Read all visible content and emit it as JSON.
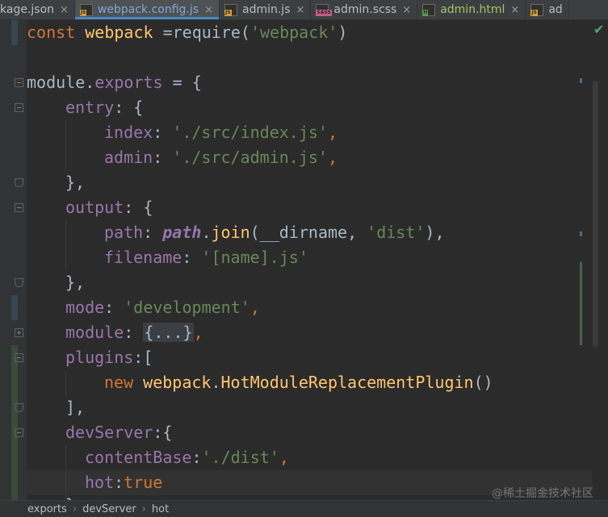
{
  "tabs": [
    {
      "label": "kage.json",
      "icon": "json-file-icon",
      "badge": "",
      "color": "#c0a35a",
      "active": false
    },
    {
      "label": "webpack.config.js",
      "icon": "js-file-icon",
      "badge": "JS",
      "color": "#d5a035",
      "active": true
    },
    {
      "label": "admin.js",
      "icon": "js-file-icon",
      "badge": "JS",
      "color": "#d5a035",
      "active": false
    },
    {
      "label": "admin.scss",
      "icon": "sass-file-icon",
      "badge": "SASS",
      "color": "#c75b84",
      "active": false
    },
    {
      "label": "admin.html",
      "icon": "html-file-icon",
      "badge": "H",
      "color": "#5b9b4c",
      "active": false
    },
    {
      "label": "ad",
      "icon": "js-file-icon",
      "badge": "JS",
      "color": "#d5a035",
      "active": false
    }
  ],
  "tab_close_glyph": "×",
  "inspection_status": "✔",
  "code": {
    "l1": {
      "a": "const ",
      "b": "webpack",
      "c": " =require(",
      "d": "'webpack'",
      "e": ")"
    },
    "l3": {
      "a": "module",
      "b": ".",
      "c": "exports",
      "d": " = {"
    },
    "l4": {
      "a": "entry",
      "b": ": {"
    },
    "l5": {
      "a": "index",
      "b": ": ",
      "c": "'./src/index.js'",
      "d": ","
    },
    "l6": {
      "a": "admin",
      "b": ": ",
      "c": "'./src/admin.js'",
      "d": ","
    },
    "l7": {
      "a": "},"
    },
    "l8": {
      "a": "output",
      "b": ": {"
    },
    "l9": {
      "a": "path",
      "b": ": ",
      "c": "path",
      "d": ".",
      "e": "join",
      "f": "(__dirname, ",
      "g": "'dist'",
      "h": "),"
    },
    "l10": {
      "a": "filename",
      "b": ": ",
      "c": "'[name].js'"
    },
    "l11": {
      "a": "},"
    },
    "l12": {
      "a": "mode",
      "b": ": ",
      "c": "'development'",
      "d": ","
    },
    "l13": {
      "a": "module",
      "b": ": ",
      "c": "{...}",
      "d": ","
    },
    "l14": {
      "a": "plugins",
      "b": ":["
    },
    "l15": {
      "a": "new ",
      "b": "webpack",
      "c": ".",
      "d": "HotModuleReplacementPlugin",
      "e": "()"
    },
    "l16": {
      "a": "],"
    },
    "l17": {
      "a": "devServer",
      "b": ":{"
    },
    "l18": {
      "a": "contentBase",
      "b": ":",
      "c": "'./dist'",
      "d": ","
    },
    "l19": {
      "a": "hot",
      "b": ":",
      "c": "true"
    },
    "l20": {
      "a": "}"
    }
  },
  "breadcrumb": [
    "exports",
    "devServer",
    "hot"
  ],
  "breadcrumb_sep": "›",
  "watermark": "@稀土掘金技术社区",
  "colors": {
    "keyword": "#cc7832",
    "string": "#6a8759",
    "property": "#9876aa",
    "function": "#ffc66d",
    "text": "#a9b7c6",
    "background": "#2b2b2b",
    "vcs_added": "#384c38",
    "vcs_modified": "#374752"
  }
}
